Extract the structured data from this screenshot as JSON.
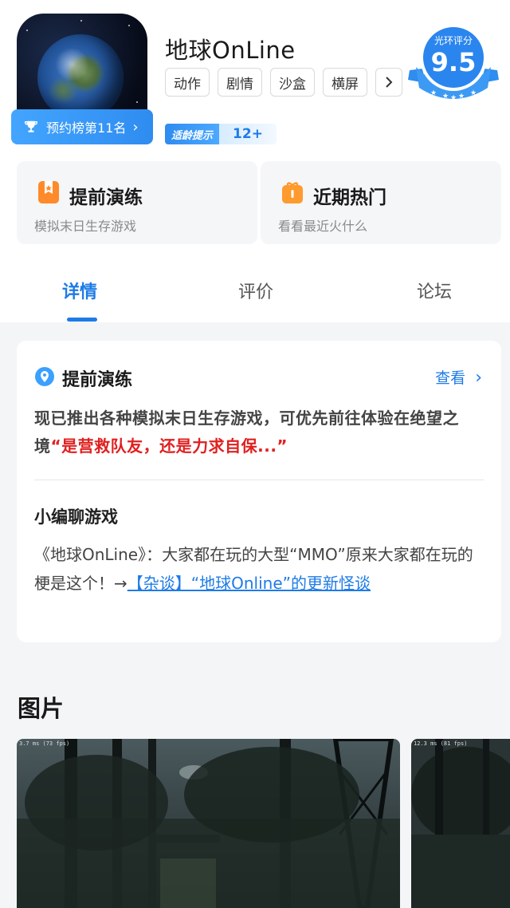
{
  "app": {
    "title": "地球OnLine",
    "rank_badge": "预约榜第11名",
    "tags": [
      "动作",
      "剧情",
      "沙盒",
      "横屏"
    ],
    "age_hint_label": "适龄提示",
    "age_rating": "12+",
    "rating_label": "光环评分",
    "rating_value": "9.5"
  },
  "features": [
    {
      "title": "提前演练",
      "subtitle": "模拟末日生存游戏",
      "icon": "bookmark-star-icon"
    },
    {
      "title": "近期热门",
      "subtitle": "看看最近火什么",
      "icon": "gift-icon"
    }
  ],
  "tabs": [
    {
      "label": "详情",
      "active": true
    },
    {
      "label": "评价",
      "active": false
    },
    {
      "label": "论坛",
      "active": false
    }
  ],
  "card": {
    "title": "提前演练",
    "view_label": "查看",
    "desc_plain": "现已推出各种模拟末日生存游戏，可优先前往体验在绝望之境",
    "desc_red": "“是营救队友，还是力求自保...”",
    "subhead": "小编聊游戏",
    "body_plain": "《地球OnLine》：大家都在玩的大型“MMO”原来大家都在玩的梗是这个！→",
    "body_link": "【杂谈】“地球Online”的更新怪谈"
  },
  "pictures": {
    "title": "图片",
    "shot1_fps": "3.7 ms (73 fps)",
    "shot2_fps": "12.3 ms (81 fps)"
  },
  "colors": {
    "accent": "#1e7be6",
    "highlight_red": "#e02020",
    "card_bg": "#f5f6f8"
  }
}
